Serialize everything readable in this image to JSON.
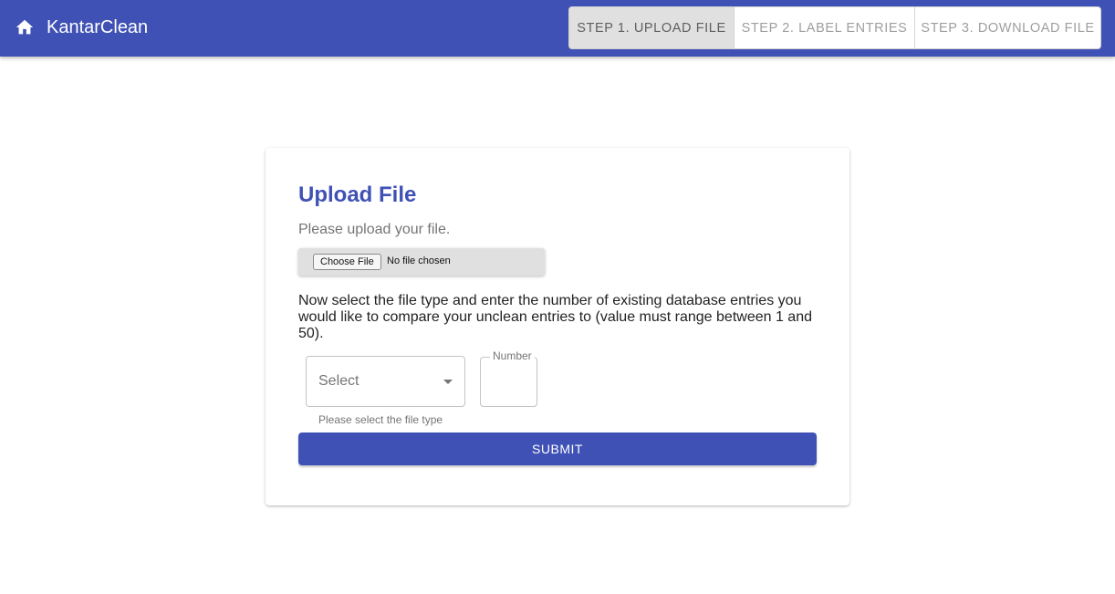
{
  "app": {
    "title": "KantarClean"
  },
  "icons": {
    "home": "home-icon",
    "select_caret": "arrow-drop-down-icon"
  },
  "colors": {
    "primary": "#3f51b5",
    "active_step_bg": "#e0e0e0"
  },
  "steps": [
    {
      "label": "STEP 1. UPLOAD FILE",
      "active": true
    },
    {
      "label": "STEP 2. LABEL ENTRIES",
      "active": false
    },
    {
      "label": "STEP 3. DOWNLOAD FILE",
      "active": false
    }
  ],
  "card": {
    "title": "Upload File",
    "prompt": "Please upload your file.",
    "file_input": {
      "button_label": "Choose File",
      "status": "No file chosen"
    },
    "instructions": "Now select the file type and enter the number of existing database entries you would like to compare your unclean entries to (value must range between 1 and 50).",
    "file_type": {
      "value": "Select",
      "helper": "Please select the file type"
    },
    "number": {
      "label": "Number",
      "value": ""
    },
    "submit_label": "SUBMIT"
  }
}
